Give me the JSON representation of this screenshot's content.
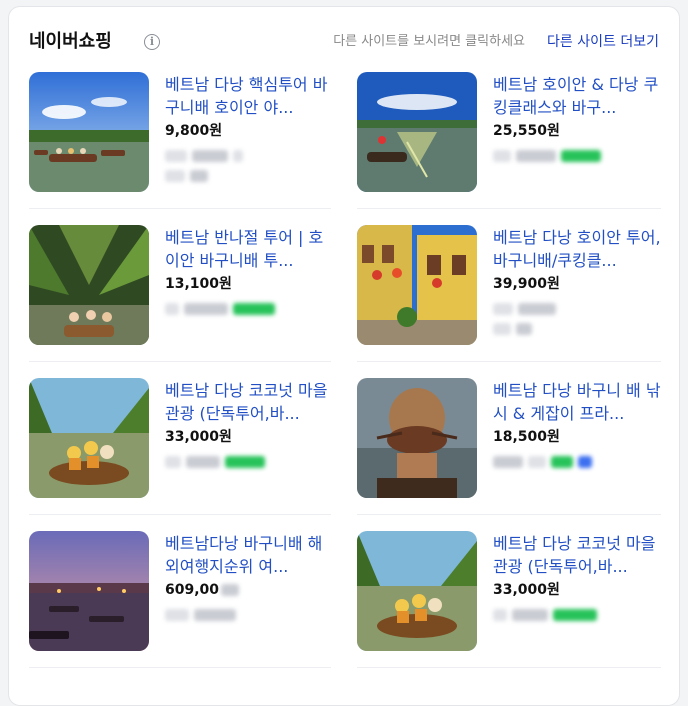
{
  "header": {
    "title": "네이버쇼핑",
    "info_icon": "info-icon",
    "hint": "다른 사이트를 보시려면 클릭하세요",
    "more_link": "다른 사이트 더보기"
  },
  "products": [
    {
      "title": "베트남 다낭 핵심투어 바구니배 호이안 야...",
      "price": "9,800원",
      "thumbnail": "river-boats-photo"
    },
    {
      "title": "베트남 호이안 & 다낭 쿠킹클래스와 바구...",
      "price": "25,550원",
      "thumbnail": "fishing-net-boat-photo"
    },
    {
      "title": "베트남 반나절 투어 | 호이안 바구니배 투...",
      "price": "13,100원",
      "thumbnail": "coconut-palm-boat-photo"
    },
    {
      "title": "베트남 다낭 호이안 투어, 바구니배/쿠킹클...",
      "price": "39,900원",
      "thumbnail": "hoian-street-photo"
    },
    {
      "title": "베트남 다낭 코코넛 마을 관광 (단독투어,바...",
      "price": "33,000원",
      "thumbnail": "basket-boat-photo"
    },
    {
      "title": "베트남 다낭 바구니 배 낚시 & 게잡이 프라...",
      "price": "18,500원",
      "thumbnail": "crab-hand-photo"
    },
    {
      "title": "베트남다낭 바구니배 해외여행지순위 여...",
      "price": "609,00",
      "thumbnail": "sunset-river-photo"
    },
    {
      "title": "베트남 다낭 코코넛 마을 관광 (단독투어,바...",
      "price": "33,000원",
      "thumbnail": "basket-boat-photo-2"
    }
  ],
  "colors": {
    "title_link": "#2250c4",
    "more_link": "#1a3dbf",
    "badge_green": "#27c35a",
    "badge_blue": "#3b6ff0"
  }
}
